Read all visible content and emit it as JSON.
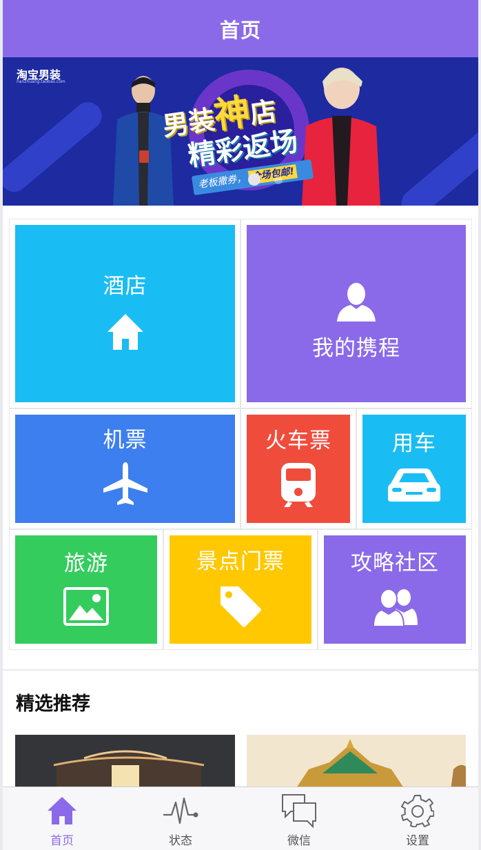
{
  "header": {
    "title": "首页"
  },
  "banner": {
    "logo": "淘宝男装",
    "logo_sub": "nanzhuang.taobao.com",
    "slogan_line1_a": "男装",
    "slogan_line1_b": "神",
    "slogan_line1_c": "店",
    "slogan_line2": "精彩返场",
    "tag_a": "老板撒券，",
    "tag_b": "全场包邮!"
  },
  "tiles": [
    {
      "id": "hotel",
      "label": "酒店",
      "icon": "home-icon",
      "color": "#19bdf3"
    },
    {
      "id": "my-trips",
      "label": "我的携程",
      "icon": "user-icon",
      "color": "#8a6ae8"
    },
    {
      "id": "flights",
      "label": "机票",
      "icon": "airplane-icon",
      "color": "#3d7fee"
    },
    {
      "id": "train",
      "label": "火车票",
      "icon": "train-icon",
      "color": "#f04c3c"
    },
    {
      "id": "car",
      "label": "用车",
      "icon": "car-icon",
      "color": "#19bdf3"
    },
    {
      "id": "travel",
      "label": "旅游",
      "icon": "image-icon",
      "color": "#35cc5e"
    },
    {
      "id": "tickets",
      "label": "景点门票",
      "icon": "tag-icon",
      "color": "#ffc800"
    },
    {
      "id": "community",
      "label": "攻略社区",
      "icon": "users-icon",
      "color": "#8a6ae8"
    }
  ],
  "section": {
    "title": "精选推荐"
  },
  "tabbar": {
    "accent": "#8a6ae8",
    "items": [
      {
        "label": "首页",
        "icon": "home-icon",
        "active": true
      },
      {
        "label": "状态",
        "icon": "pulse-icon",
        "active": false
      },
      {
        "label": "微信",
        "icon": "chat-icon",
        "active": false
      },
      {
        "label": "设置",
        "icon": "gear-icon",
        "active": false
      }
    ]
  }
}
